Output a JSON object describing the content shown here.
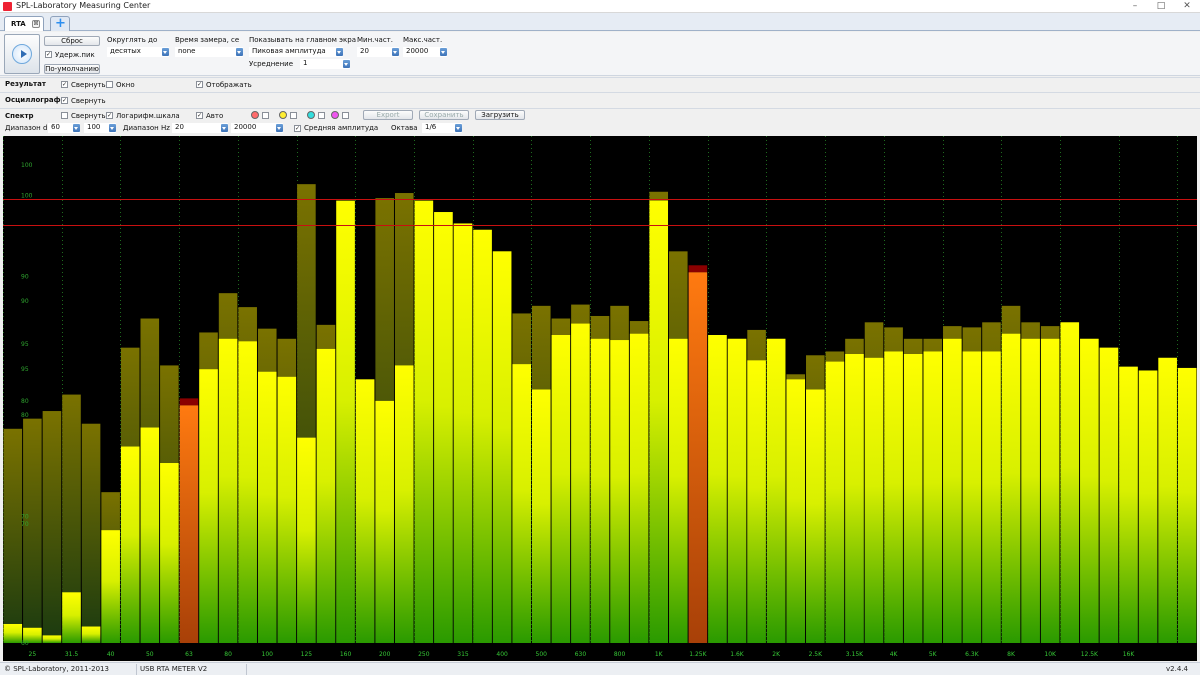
{
  "window": {
    "title": "SPL-Laboratory Measuring Center",
    "minimize": "–",
    "maximize": "□",
    "close": "✕"
  },
  "tabs": {
    "active_label": "RTA",
    "close_glyph": "⊠",
    "add_glyph": "+"
  },
  "controls": {
    "reset_label": "Сброс",
    "hold_peak_label": "Удерж.пик",
    "hold_peak_checked": true,
    "defaults_label": "По-умолчанию",
    "round_label": "Округлять до",
    "round_value": "десятых",
    "time_label": "Время замера, се",
    "time_value": "none",
    "show_label": "Показывать на главном экра",
    "show_value": "Пиковая амплитуда",
    "averaging_label": "Усреднение",
    "averaging_value": "1",
    "min_freq_label": "Мин.част.",
    "min_freq_value": "20",
    "max_freq_label": "Макс.част.",
    "max_freq_value": "20000"
  },
  "result_row": {
    "label": "Результат",
    "collapse_label": "Свернуть",
    "collapse_checked": true,
    "window_label": "Окно",
    "window_checked": false,
    "display_label": "Отображать",
    "display_checked": true
  },
  "osc_row": {
    "label": "Осциллограф",
    "collapse_label": "Свернуть",
    "collapse_checked": true
  },
  "spectrum_row": {
    "label": "Спектр",
    "collapse_label": "Свернуть",
    "collapse_checked": false,
    "log_label": "Логарифм.шкала",
    "log_checked": true,
    "auto_label": "Авто",
    "auto_checked": true,
    "color_chips": [
      "#ff6b6b",
      "#ffee33",
      "#33dddd",
      "#ee55ee"
    ],
    "export_label": "Export",
    "save_label": "Сохранить",
    "load_label": "Загрузить",
    "db_range_label": "Диапазон dB",
    "db_min": "60",
    "db_max": "100",
    "hz_range_label": "Диапазон Hz",
    "hz_min": "20",
    "hz_max": "20000",
    "avg_amp_label": "Средняя амплитуда",
    "avg_amp_checked": true,
    "octave_label": "Октава",
    "octave_value": "1/6"
  },
  "chart_data": {
    "type": "bar",
    "scale_db": [
      60,
      100
    ],
    "ref_lines_db": [
      95,
      93
    ],
    "y_tick_labels": [
      {
        "label": "100",
        "db": 97.7
      },
      {
        "label": "100",
        "db": 95.3
      },
      {
        "label": "90",
        "db": 88.9
      },
      {
        "label": "90",
        "db": 87.0
      },
      {
        "label": "95",
        "db": 83.6
      },
      {
        "label": "95",
        "db": 81.6
      },
      {
        "label": "80",
        "db": 79.1
      },
      {
        "label": "80",
        "db": 78.0
      },
      {
        "label": "70",
        "db": 70.0
      },
      {
        "label": "70",
        "db": 69.4
      },
      {
        "label": "60",
        "db": 60.0
      }
    ],
    "x_tick_labels": [
      "25",
      "31.5",
      "40",
      "50",
      "63",
      "80",
      "100",
      "125",
      "160",
      "200",
      "250",
      "315",
      "400",
      "500",
      "630",
      "800",
      "1K",
      "1.25K",
      "1.6K",
      "2K",
      "2.5K",
      "3.15K",
      "4K",
      "5K",
      "6.3K",
      "8K",
      "10K",
      "12.5K",
      "16K"
    ],
    "current_db": [
      61.5,
      61.2,
      60.6,
      64.0,
      61.3,
      68.9,
      75.5,
      77.0,
      74.2,
      77.8,
      81.6,
      84.0,
      83.8,
      81.4,
      81.0,
      76.2,
      83.2,
      94.9,
      80.8,
      79.1,
      81.9,
      94.9,
      94.0,
      93.1,
      92.6,
      90.9,
      82.0,
      80.0,
      84.3,
      85.2,
      84.0,
      83.9,
      84.4,
      94.9,
      84.0,
      83.0,
      84.3,
      84.0,
      82.3,
      84.0,
      80.8,
      80.0,
      82.2,
      82.8,
      82.5,
      83.0,
      82.8,
      83.0,
      84.0,
      83.0,
      83.0,
      84.4,
      84.0,
      84.0,
      85.3,
      84.0,
      83.3,
      81.8,
      81.5,
      82.5,
      81.7
    ],
    "peak_db": [
      76.9,
      77.7,
      78.3,
      79.6,
      77.3,
      71.9,
      83.3,
      85.6,
      81.9,
      79.3,
      84.5,
      87.6,
      86.5,
      84.8,
      84.0,
      96.2,
      85.1,
      78.6,
      80.0,
      95.1,
      95.5,
      94.5,
      93.5,
      85.2,
      83.3,
      79.6,
      86.0,
      86.6,
      85.6,
      86.7,
      85.8,
      86.6,
      85.4,
      95.6,
      90.9,
      89.8,
      83.9,
      83.9,
      84.7,
      82.3,
      81.2,
      82.7,
      83.0,
      84.0,
      85.3,
      84.9,
      84.0,
      84.0,
      85.0,
      84.9,
      85.3,
      86.6,
      85.3,
      85.0,
      83.9,
      83.0,
      81.9,
      81.5,
      81.5,
      81.0,
      80.8
    ],
    "highlighted_bands": [
      9,
      35
    ]
  },
  "status": {
    "copyright": "© SPL-Laboratory, 2011-2013",
    "device": "USB RTA METER V2",
    "version": "v2.4.4"
  }
}
